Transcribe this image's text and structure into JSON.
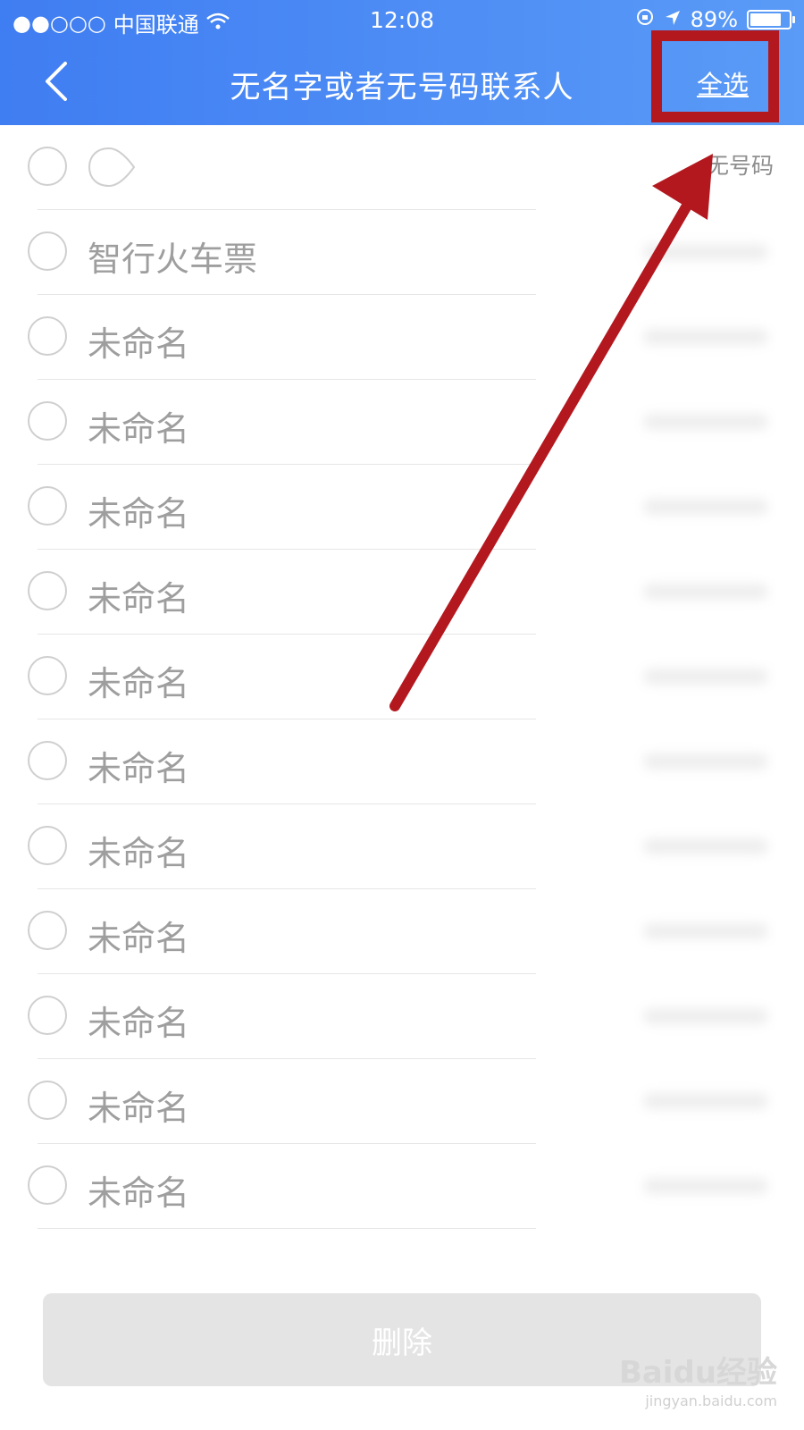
{
  "status_bar": {
    "signal": "●●○○○",
    "carrier": "中国联通",
    "time": "12:08",
    "battery": "89%",
    "battery_level": 0.89
  },
  "nav": {
    "back_icon": "chevron-left-icon",
    "title": "无名字或者无号码联系人",
    "select_all": "全选"
  },
  "contacts": [
    {
      "name": "",
      "detail": "无号码"
    },
    {
      "name": "智行火车票",
      "detail": ""
    },
    {
      "name": "未命名",
      "detail": ""
    },
    {
      "name": "未命名",
      "detail": ""
    },
    {
      "name": "未命名",
      "detail": ""
    },
    {
      "name": "未命名",
      "detail": ""
    },
    {
      "name": "未命名",
      "detail": ""
    },
    {
      "name": "未命名",
      "detail": ""
    },
    {
      "name": "未命名",
      "detail": ""
    },
    {
      "name": "未命名",
      "detail": ""
    },
    {
      "name": "未命名",
      "detail": ""
    },
    {
      "name": "未命名",
      "detail": ""
    },
    {
      "name": "未命名",
      "detail": ""
    }
  ],
  "delete_button": "删除",
  "watermark": {
    "logo": "Baidu经验",
    "url": "jingyan.baidu.com"
  },
  "colors": {
    "header_start": "#3f7df2",
    "header_end": "#5a9bf7",
    "annotation": "#b4181f"
  }
}
